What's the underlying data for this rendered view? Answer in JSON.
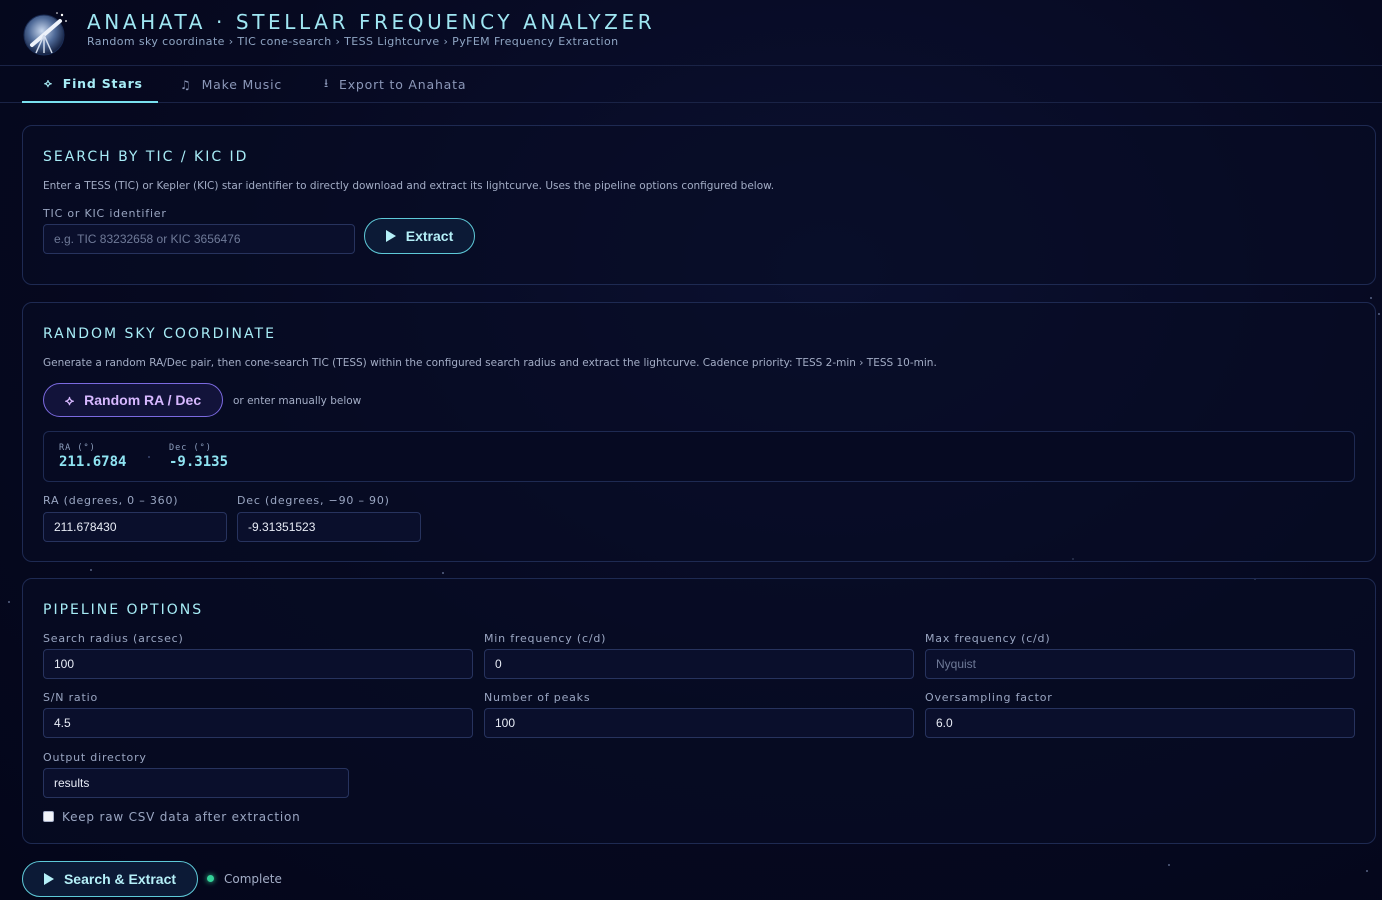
{
  "header": {
    "title": "ANAHATA · STELLAR FREQUENCY ANALYZER",
    "subtitle": "Random sky coordinate › TIC cone-search › TESS Lightcurve › PyFEM Frequency Extraction",
    "logo_icon": "telescope-logo-icon"
  },
  "tabs": [
    {
      "label": "Find Stars",
      "icon": "telescope-icon",
      "glyph": "⟡",
      "active": true
    },
    {
      "label": "Make Music",
      "icon": "music-note-icon",
      "glyph": "♫",
      "active": false
    },
    {
      "label": "Export to Anahata",
      "icon": "download-icon",
      "glyph": "⭳",
      "active": false
    }
  ],
  "search_panel": {
    "title": "SEARCH BY TIC / KIC ID",
    "description": "Enter a TESS (TIC) or Kepler (KIC) star identifier to directly download and extract its lightcurve. Uses the pipeline options configured below.",
    "field_label": "TIC or KIC identifier",
    "placeholder": "e.g. TIC 83232658 or KIC 3656476",
    "value": "",
    "button_label": "Extract"
  },
  "random_panel": {
    "title": "RANDOM SKY COORDINATE",
    "description": "Generate a random RA/Dec pair, then cone-search TIC (TESS) within the configured search radius and extract the lightcurve. Cadence priority: TESS 2-min › TESS 10-min.",
    "button_label": "Random RA / Dec",
    "hint": "or enter manually below",
    "ra_label": "RA (°)",
    "ra_value": "211.6784",
    "dec_label": "Dec (°)",
    "dec_value": "-9.3135",
    "ra_input_label": "RA (degrees, 0 – 360)",
    "ra_input_value": "211.678430",
    "dec_input_label": "Dec (degrees, −90 – 90)",
    "dec_input_value": "-9.31351523"
  },
  "pipeline": {
    "title": "PIPELINE OPTIONS",
    "search_radius_label": "Search radius (arcsec)",
    "search_radius_value": "100",
    "min_freq_label": "Min frequency (c/d)",
    "min_freq_value": "0",
    "max_freq_label": "Max frequency (c/d)",
    "max_freq_placeholder": "Nyquist",
    "sn_label": "S/N ratio",
    "sn_value": "4.5",
    "peaks_label": "Number of peaks",
    "peaks_value": "100",
    "oversampling_label": "Oversampling factor",
    "oversampling_value": "6.0",
    "output_dir_label": "Output directory",
    "output_dir_value": "results",
    "keep_csv_label": "Keep raw CSV data after extraction",
    "keep_csv_checked": false
  },
  "footer": {
    "button_label": "Search & Extract",
    "status_text": "Complete",
    "status_color": "#34d399"
  },
  "colors": {
    "accent": "#79e0ef",
    "purple": "#7b6ae0",
    "background": "#070a1e"
  }
}
